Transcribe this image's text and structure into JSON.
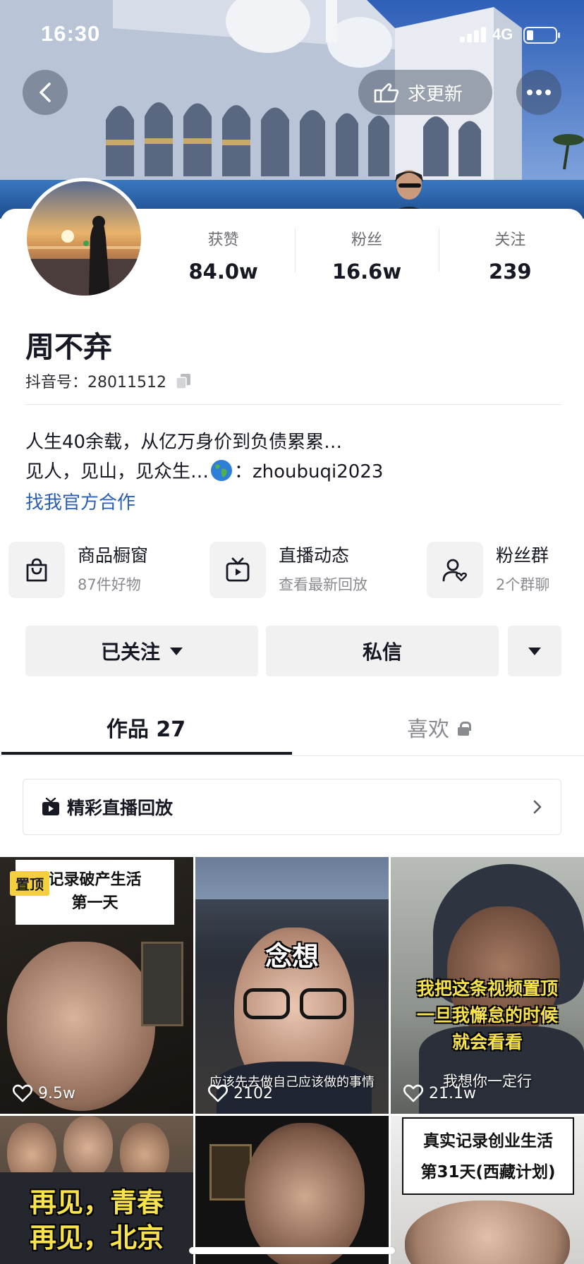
{
  "status_bar": {
    "time": "16:30",
    "network": "4G"
  },
  "header": {
    "request_update_label": "求更新"
  },
  "profile": {
    "name": "周不弃",
    "douyin_id": "抖音号：28011512",
    "stats": [
      {
        "label": "获赞",
        "value": "84.0w"
      },
      {
        "label": "粉丝",
        "value": "16.6w"
      },
      {
        "label": "关注",
        "value": "239"
      }
    ],
    "bio": {
      "line1": "人生40余载，从亿万身价到负债累累…",
      "line2_prefix": "见人，见山，见众生…",
      "line2_suffix": "：zhoubuqi2023"
    },
    "cooperation_link": "找我官方合作"
  },
  "features": [
    {
      "title": "商品橱窗",
      "subtitle": "87件好物",
      "icon": "shopping-bag-icon"
    },
    {
      "title": "直播动态",
      "subtitle": "查看最新回放",
      "icon": "tv-icon"
    },
    {
      "title": "粉丝群",
      "subtitle": "2个群聊",
      "icon": "fan-group-icon"
    }
  ],
  "actions": {
    "followed_label": "已关注",
    "message_label": "私信"
  },
  "tabs": {
    "works_label": "作品 27",
    "likes_label": "喜欢"
  },
  "live_replay": {
    "label": "精彩直播回放"
  },
  "videos": [
    {
      "likes": "9.5w",
      "pinned": "置顶",
      "caption": "记录破产生活\n第一天"
    },
    {
      "likes": "2102",
      "caption": "念想",
      "subtitle": "应该先去做自己应该做的事情"
    },
    {
      "likes": "21.1w",
      "caption": "我把这条视频置顶\n一旦我懈怠的时候\n就会看看",
      "subtitle": "我想你一定行"
    },
    {
      "caption": "再见，青春\n再见，北京"
    },
    {},
    {
      "caption": "真实记录创业生活\n第31天(西藏计划)"
    }
  ],
  "colors": {
    "link": "#2b5fb6",
    "pin_badge": "#f6cf3e",
    "caption_yellow": "#f8e34a"
  }
}
